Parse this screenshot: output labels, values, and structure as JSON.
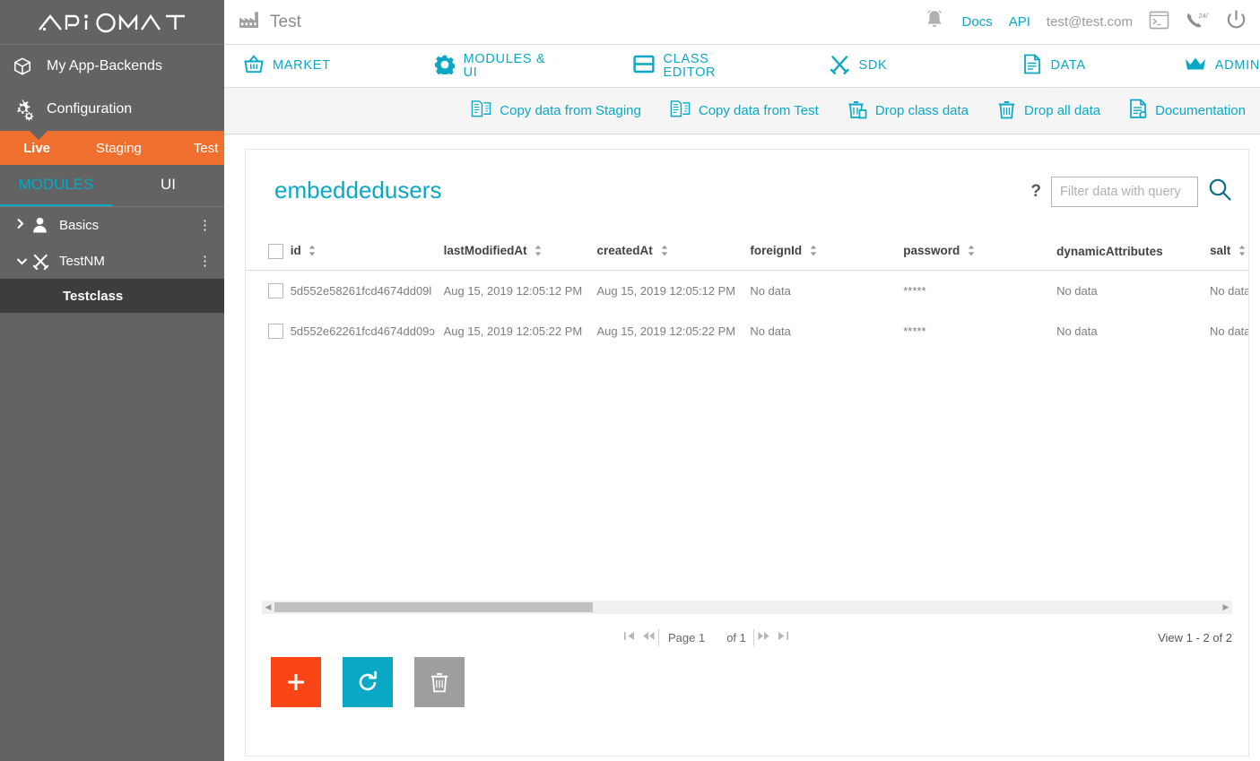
{
  "brand": {
    "logo_text": "APiOMAT",
    "accent_teal": "#0aa8c4",
    "accent_orange": "#ef6f2e",
    "add_orange": "#fa4616",
    "sidebar_grey": "#636363"
  },
  "sidebar": {
    "links": [
      {
        "label": "My App-Backends",
        "icon": "cube-icon"
      },
      {
        "label": "Configuration",
        "icon": "gears-icon"
      }
    ],
    "environments": [
      {
        "label": "Live",
        "active": true
      },
      {
        "label": "Staging",
        "active": false
      },
      {
        "label": "Test",
        "active": false
      }
    ],
    "tabs": [
      {
        "label": "MODULES",
        "active": true
      },
      {
        "label": "UI",
        "active": false
      }
    ],
    "tree": [
      {
        "label": "Basics",
        "icon": "person-icon",
        "expanded": false,
        "caret": "›",
        "kebab": "⋮"
      },
      {
        "label": "TestNM",
        "icon": "tools-icon",
        "expanded": true,
        "caret": "⌄",
        "kebab": "⋮"
      }
    ],
    "tree_child": {
      "label": "Testclass",
      "selected": true
    }
  },
  "topbar": {
    "app_icon": "factory-icon",
    "app_name": "Test",
    "bell_icon": "bell-icon",
    "docs_label": "Docs",
    "api_label": "API",
    "user_email": "test@test.com",
    "terminal_icon": "terminal-icon",
    "support_icon": "phone-247-icon",
    "power_icon": "power-icon"
  },
  "navtabs": [
    {
      "label": "MARKET",
      "icon": "basket-icon",
      "active": false
    },
    {
      "label": "MODULES & UI",
      "icon": "gear-icon",
      "active": false
    },
    {
      "label": "CLASS EDITOR",
      "icon": "class-editor-icon",
      "active": false
    },
    {
      "label": "SDK",
      "icon": "tools-icon",
      "active": false
    },
    {
      "label": "DATA",
      "icon": "document-icon",
      "active": true
    },
    {
      "label": "ADMIN",
      "icon": "crown-icon",
      "active": false
    }
  ],
  "actionbar": [
    {
      "label": "Copy data from Staging",
      "icon": "copy-docs-icon"
    },
    {
      "label": "Copy data from Test",
      "icon": "copy-docs-icon"
    },
    {
      "label": "Drop class data",
      "icon": "trash-class-icon"
    },
    {
      "label": "Drop all data",
      "icon": "trash-icon"
    },
    {
      "label": "Documentation",
      "icon": "doc-info-icon"
    }
  ],
  "panel": {
    "title": "embeddedusers",
    "help_glyph": "?",
    "filter_placeholder": "Filter data with query",
    "filter_value": "",
    "search_icon": "search-icon"
  },
  "table": {
    "columns": [
      {
        "key": "checkbox",
        "label": "",
        "sortable": false
      },
      {
        "key": "id",
        "label": "id",
        "sortable": true
      },
      {
        "key": "lastModifiedAt",
        "label": "lastModifiedAt",
        "sortable": true
      },
      {
        "key": "createdAt",
        "label": "createdAt",
        "sortable": true
      },
      {
        "key": "foreignId",
        "label": "foreignId",
        "sortable": true
      },
      {
        "key": "password",
        "label": "password",
        "sortable": true
      },
      {
        "key": "dynamicAttributes",
        "label": "dynamicAttributes",
        "sortable": false
      },
      {
        "key": "salt",
        "label": "salt",
        "sortable": true
      }
    ],
    "rows": [
      {
        "id": "5d552e58261fcd4674dd09l",
        "lastModifiedAt": "Aug 15, 2019 12:05:12 PM",
        "createdAt": "Aug 15, 2019 12:05:12 PM",
        "foreignId": "No data",
        "password": "*****",
        "dynamicAttributes": "No data",
        "salt": "No data"
      },
      {
        "id": "5d552e62261fcd4674dd09ɔ",
        "lastModifiedAt": "Aug 15, 2019 12:05:22 PM",
        "createdAt": "Aug 15, 2019 12:05:22 PM",
        "foreignId": "No data",
        "password": "*****",
        "dynamicAttributes": "No data",
        "salt": "No data"
      }
    ]
  },
  "pager": {
    "first_icon": "⧏│",
    "prev_icon": "≪",
    "page_label": "Page 1",
    "of_label": "of 1",
    "next_icon": "≫",
    "last_icon": "│⧐",
    "view_label": "View 1 - 2 of 2"
  },
  "footer_buttons": [
    {
      "name": "add",
      "glyph": "+",
      "color": "#fa4616"
    },
    {
      "name": "refresh",
      "glyph": "⟳",
      "color": "#0aa8c4"
    },
    {
      "name": "delete",
      "glyph": "Ὕ1",
      "color": "#9e9e9e"
    }
  ]
}
